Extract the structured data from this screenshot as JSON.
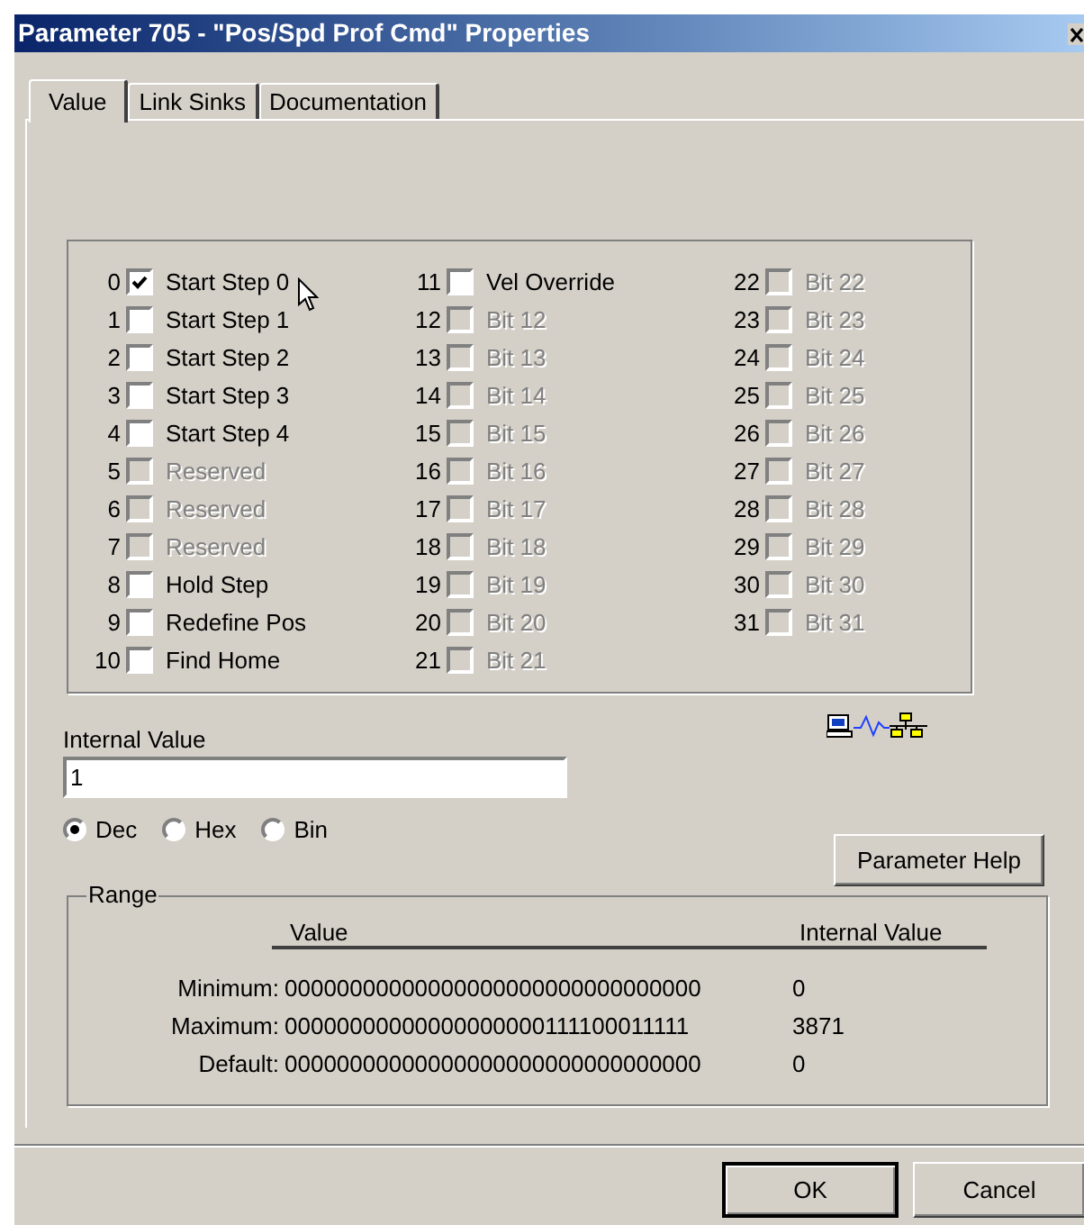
{
  "window": {
    "title": "Parameter 705 - \"Pos/Spd Prof Cmd\" Properties"
  },
  "tabs": [
    {
      "label": "Value",
      "selected": true
    },
    {
      "label": "Link Sinks",
      "selected": false
    },
    {
      "label": "Documentation",
      "selected": false
    }
  ],
  "bits": [
    {
      "number": "0",
      "label": "Start Step 0",
      "checked": true,
      "disabled": false
    },
    {
      "number": "1",
      "label": "Start Step 1",
      "checked": false,
      "disabled": false
    },
    {
      "number": "2",
      "label": "Start Step 2",
      "checked": false,
      "disabled": false
    },
    {
      "number": "3",
      "label": "Start Step 3",
      "checked": false,
      "disabled": false
    },
    {
      "number": "4",
      "label": "Start Step 4",
      "checked": false,
      "disabled": false
    },
    {
      "number": "5",
      "label": "Reserved",
      "checked": false,
      "disabled": true
    },
    {
      "number": "6",
      "label": "Reserved",
      "checked": false,
      "disabled": true
    },
    {
      "number": "7",
      "label": "Reserved",
      "checked": false,
      "disabled": true
    },
    {
      "number": "8",
      "label": "Hold Step",
      "checked": false,
      "disabled": false
    },
    {
      "number": "9",
      "label": "Redefine Pos",
      "checked": false,
      "disabled": false
    },
    {
      "number": "10",
      "label": "Find Home",
      "checked": false,
      "disabled": false
    },
    {
      "number": "11",
      "label": "Vel Override",
      "checked": false,
      "disabled": false
    },
    {
      "number": "12",
      "label": "Bit 12",
      "checked": false,
      "disabled": true
    },
    {
      "number": "13",
      "label": "Bit 13",
      "checked": false,
      "disabled": true
    },
    {
      "number": "14",
      "label": "Bit 14",
      "checked": false,
      "disabled": true
    },
    {
      "number": "15",
      "label": "Bit 15",
      "checked": false,
      "disabled": true
    },
    {
      "number": "16",
      "label": "Bit 16",
      "checked": false,
      "disabled": true
    },
    {
      "number": "17",
      "label": "Bit 17",
      "checked": false,
      "disabled": true
    },
    {
      "number": "18",
      "label": "Bit 18",
      "checked": false,
      "disabled": true
    },
    {
      "number": "19",
      "label": "Bit 19",
      "checked": false,
      "disabled": true
    },
    {
      "number": "20",
      "label": "Bit 20",
      "checked": false,
      "disabled": true
    },
    {
      "number": "21",
      "label": "Bit 21",
      "checked": false,
      "disabled": true
    },
    {
      "number": "22",
      "label": "Bit 22",
      "checked": false,
      "disabled": true
    },
    {
      "number": "23",
      "label": "Bit 23",
      "checked": false,
      "disabled": true
    },
    {
      "number": "24",
      "label": "Bit 24",
      "checked": false,
      "disabled": true
    },
    {
      "number": "25",
      "label": "Bit 25",
      "checked": false,
      "disabled": true
    },
    {
      "number": "26",
      "label": "Bit 26",
      "checked": false,
      "disabled": true
    },
    {
      "number": "27",
      "label": "Bit 27",
      "checked": false,
      "disabled": true
    },
    {
      "number": "28",
      "label": "Bit 28",
      "checked": false,
      "disabled": true
    },
    {
      "number": "29",
      "label": "Bit 29",
      "checked": false,
      "disabled": true
    },
    {
      "number": "30",
      "label": "Bit 30",
      "checked": false,
      "disabled": true
    },
    {
      "number": "31",
      "label": "Bit 31",
      "checked": false,
      "disabled": true
    }
  ],
  "internal_value": {
    "label": "Internal Value",
    "value": "1"
  },
  "radix": [
    {
      "label": "Dec",
      "selected": true
    },
    {
      "label": "Hex",
      "selected": false
    },
    {
      "label": "Bin",
      "selected": false
    }
  ],
  "parameter_help_button": "Parameter Help",
  "range": {
    "title": "Range",
    "columns": [
      "Value",
      "Internal Value"
    ],
    "rows": [
      {
        "label": "Minimum:",
        "value": "00000000000000000000000000000000",
        "internal": "0"
      },
      {
        "label": "Maximum:",
        "value": "00000000000000000000111100011111",
        "internal": "3871"
      },
      {
        "label": "Default:",
        "value": "00000000000000000000000000000000",
        "internal": "0"
      }
    ]
  },
  "buttons": [
    "OK",
    "Cancel"
  ]
}
